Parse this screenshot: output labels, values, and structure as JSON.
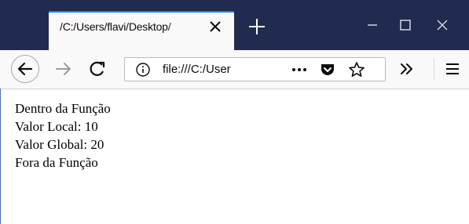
{
  "browser": {
    "tab": {
      "title": "/C:/Users/flavi/Desktop/"
    },
    "urlbar": {
      "text": "file:///C:/User"
    },
    "icons": {
      "close_tab": "close-icon",
      "new_tab": "plus-icon",
      "minimize": "minimize-icon",
      "maximize": "maximize-icon",
      "close_window": "close-icon",
      "back": "back-arrow-icon",
      "forward": "forward-arrow-icon",
      "reload": "reload-icon",
      "site_info": "info-icon",
      "page_actions": "ellipsis-icon",
      "pocket": "pocket-icon",
      "bookmark": "star-icon",
      "overflow": "chevron-double-right-icon",
      "menu": "hamburger-menu-icon"
    },
    "colors": {
      "titlebar": "#212a4f",
      "accent": "#0a84ff",
      "toolbar": "#f9f9fa"
    }
  },
  "page": {
    "lines": [
      "Dentro da Função",
      "Valor Local: 10",
      "Valor Global: 20",
      "Fora da Função"
    ]
  }
}
